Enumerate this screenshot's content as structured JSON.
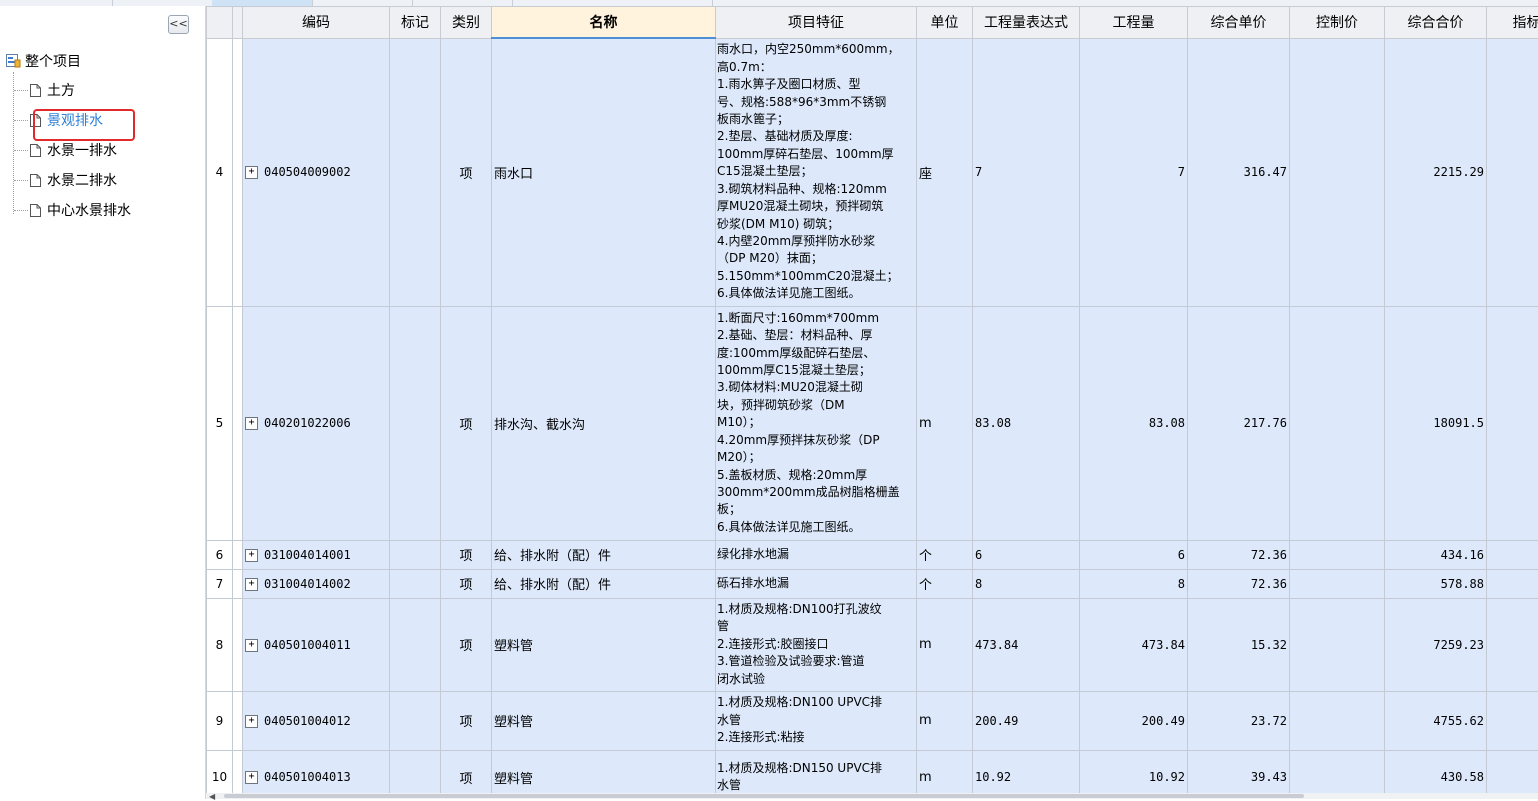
{
  "sidebar": {
    "collapse_label": "<<",
    "root": {
      "label": "整个项目",
      "icon": "project-tree-icon"
    },
    "items": [
      {
        "label": "土方",
        "icon": "document-icon",
        "selected": false
      },
      {
        "label": "景观排水",
        "icon": "document-icon",
        "selected": true
      },
      {
        "label": "水景一排水",
        "icon": "document-icon",
        "selected": false
      },
      {
        "label": "水景二排水",
        "icon": "document-icon",
        "selected": false
      },
      {
        "label": "中心水景排水",
        "icon": "document-icon",
        "selected": false
      }
    ]
  },
  "table": {
    "headers": [
      "编码",
      "标记",
      "类别",
      "名称",
      "项目特征",
      "单位",
      "工程量表达式",
      "工程量",
      "综合单价",
      "控制价",
      "综合合价",
      "指标"
    ],
    "expand_symbol": "+",
    "rows": [
      {
        "no": "4",
        "code": "040504009002",
        "mark": "",
        "type": "项",
        "name": "雨水口",
        "feature": [
          "雨水口，内空250mm*600mm，",
          "高0.7m：",
          "1.雨水箅子及圈口材质、型",
          "号、规格:588*96*3mm不锈钢",
          "板雨水篦子；",
          "2.垫层、基础材质及厚度:",
          "100mm厚碎石垫层、100mm厚",
          "C15混凝土垫层；",
          "3.砌筑材料品种、规格:120mm",
          "厚MU20混凝土砌块，预拌砌筑",
          "砂浆(DM M10) 砌筑；",
          "4.内壁20mm厚预拌防水砂浆",
          "（DP M20）抹面；",
          "5.150mm*100mmC20混凝土；",
          "6.具体做法详见施工图纸。"
        ],
        "unit": "座",
        "expr": "7",
        "qty": "7",
        "unit_price": "316.47",
        "control": "",
        "total": "2215.29"
      },
      {
        "no": "5",
        "code": "040201022006",
        "mark": "",
        "type": "项",
        "name": "排水沟、截水沟",
        "feature": [
          "1.断面尺寸:160mm*700mm",
          "2.基础、垫层：材料品种、厚",
          "度:100mm厚级配碎石垫层、",
          "100mm厚C15混凝土垫层；",
          "3.砌体材料:MU20混凝土砌",
          "块，预拌砌筑砂浆（DM",
          "M10）；",
          "4.20mm厚预拌抹灰砂浆（DP",
          "M20）；",
          "5.盖板材质、规格:20mm厚",
          "300mm*200mm成品树脂格栅盖",
          "板；",
          "6.具体做法详见施工图纸。"
        ],
        "unit": "m",
        "expr": "83.08",
        "qty": "83.08",
        "unit_price": "217.76",
        "control": "",
        "total": "18091.5"
      },
      {
        "no": "6",
        "code": "031004014001",
        "mark": "",
        "type": "项",
        "name": "给、排水附（配）件",
        "feature": [
          "绿化排水地漏"
        ],
        "unit": "个",
        "expr": "6",
        "qty": "6",
        "unit_price": "72.36",
        "control": "",
        "total": "434.16"
      },
      {
        "no": "7",
        "code": "031004014002",
        "mark": "",
        "type": "项",
        "name": "给、排水附（配）件",
        "feature": [
          "砾石排水地漏"
        ],
        "unit": "个",
        "expr": "8",
        "qty": "8",
        "unit_price": "72.36",
        "control": "",
        "total": "578.88"
      },
      {
        "no": "8",
        "code": "040501004011",
        "mark": "",
        "type": "项",
        "name": "塑料管",
        "feature": [
          "1.材质及规格:DN100打孔波纹",
          "管",
          "2.连接形式:胶圈接口",
          "3.管道检验及试验要求:管道",
          "闭水试验"
        ],
        "unit": "m",
        "expr": "473.84",
        "qty": "473.84",
        "unit_price": "15.32",
        "control": "",
        "total": "7259.23"
      },
      {
        "no": "9",
        "code": "040501004012",
        "mark": "",
        "type": "项",
        "name": "塑料管",
        "feature": [
          "1.材质及规格:DN100 UPVC排",
          "水管",
          "2.连接形式:粘接"
        ],
        "unit": "m",
        "expr": "200.49",
        "qty": "200.49",
        "unit_price": "23.72",
        "control": "",
        "total": "4755.62"
      },
      {
        "no": "10",
        "code": "040501004013",
        "mark": "",
        "type": "项",
        "name": "塑料管",
        "feature": [
          "1.材质及规格:DN150 UPVC排",
          "水管"
        ],
        "unit": "m",
        "expr": "10.92",
        "qty": "10.92",
        "unit_price": "39.43",
        "control": "",
        "total": "430.58"
      }
    ]
  }
}
